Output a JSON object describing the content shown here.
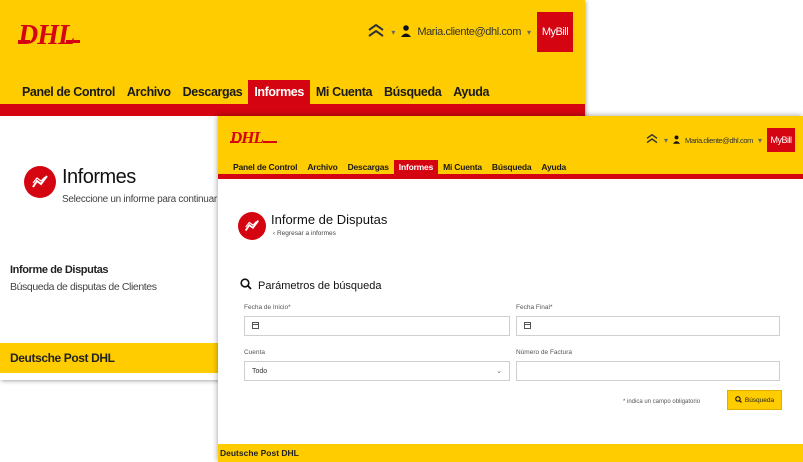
{
  "brand": {
    "logo": "DHL",
    "mybill": "MyBill",
    "footer": "Deutsche Post DHL"
  },
  "user": {
    "email": "Maria.cliente@dhl.com"
  },
  "nav": [
    "Panel de Control",
    "Archivo",
    "Descargas",
    "Informes",
    "Mi Cuenta",
    "Búsqueda",
    "Ayuda"
  ],
  "nav_active": "Informes",
  "back": {
    "title": "Informes",
    "subtitle": "Seleccione un informe para continuar",
    "links": [
      "Informe de Disputas",
      "Búsqueda de disputas de Clientes"
    ]
  },
  "front": {
    "title": "Informe de Disputas",
    "back_link": "Regresar a informes",
    "search_header": "Parámetros de búsqueda",
    "fields": {
      "start_label": "Fecha de Inicio*",
      "end_label": "Fecha Final*",
      "account_label": "Cuenta",
      "account_value": "Todo",
      "invoice_label": "Número de Factura",
      "invoice_value": ""
    },
    "required_note": "* indica un campo obligatorio",
    "search_button": "Búsqueda"
  },
  "colors": {
    "yellow": "#ffcc00",
    "red": "#d40511"
  }
}
